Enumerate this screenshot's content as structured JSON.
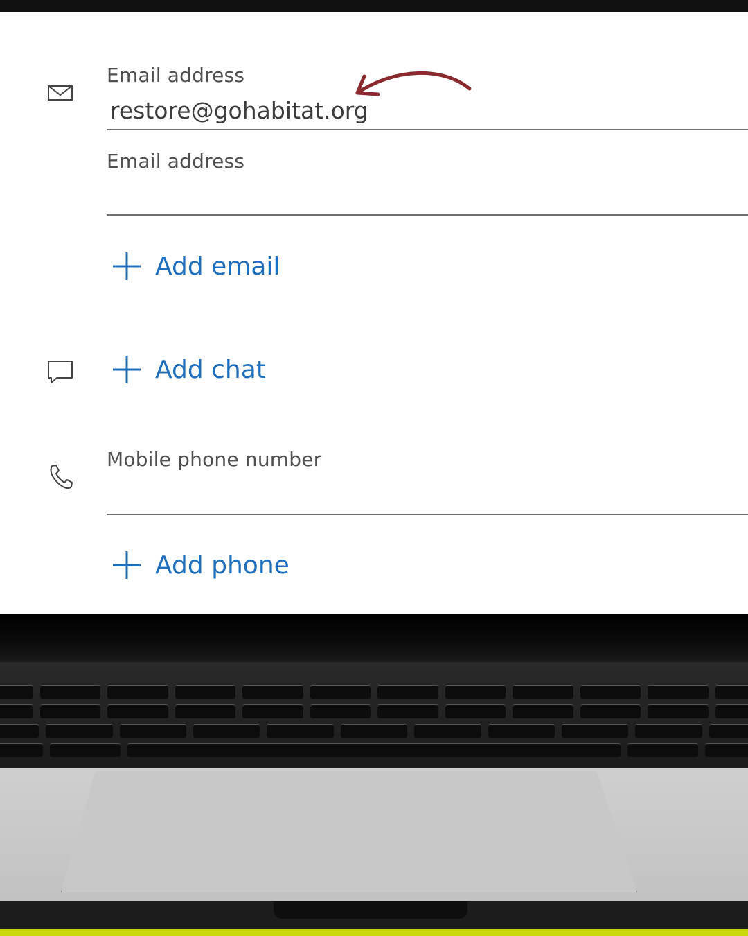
{
  "contact_form": {
    "email_1": {
      "label": "Email address",
      "value": "restore@gohabitat.org"
    },
    "email_2": {
      "label": "Email address",
      "value": ""
    },
    "add_email_label": "Add email",
    "add_chat_label": "Add chat",
    "phone": {
      "label": "Mobile phone number",
      "value": ""
    },
    "add_phone_label": "Add phone"
  },
  "icons": {
    "email": "mail-icon",
    "chat": "chat-icon",
    "phone": "phone-icon",
    "add": "plus-icon"
  },
  "colors": {
    "accent": "#1f6fbf",
    "annotation_arrow": "#8b2a2e",
    "ground": "#c8d80a"
  }
}
